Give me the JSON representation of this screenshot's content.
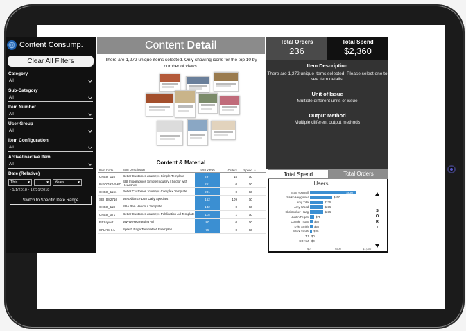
{
  "colors": {
    "accent_blue": "#3b8fd2",
    "panel_dark": "#111111",
    "panel_gray": "#333333",
    "header_gray": "#8b8b8b"
  },
  "brand": {
    "title": "Content Consump.",
    "icon": "globe-icon"
  },
  "filters": {
    "clear_label": "Clear All Filters",
    "items": [
      {
        "label": "Category",
        "value": "All"
      },
      {
        "label": "Sub-Category",
        "value": "All"
      },
      {
        "label": "Item Number",
        "value": "All"
      },
      {
        "label": "User Group",
        "value": "All"
      },
      {
        "label": "Item Configuration",
        "value": "All"
      },
      {
        "label": "Active/Inactive Item",
        "value": "All"
      }
    ],
    "date": {
      "label": "Date (Relative)",
      "mode": "This",
      "count": "",
      "unit": "Years",
      "range": "1/1/2018 - 12/31/2018"
    },
    "switch_label": "Switch to Specific Date Range"
  },
  "header": {
    "title_light": "Content ",
    "title_bold": "Detail"
  },
  "selection_message": "There are 1,272 unique items selected.  Only showing icons for the top 10 by number of views.",
  "content_material": {
    "title": "Content & Material",
    "columns": [
      "Item Code",
      "Item Description",
      "Item Views",
      "Orders",
      "Spend"
    ],
    "rows": [
      {
        "code": "CHSU_115",
        "desc": "Better Customer Journeys<br>Simple Template",
        "views": "297",
        "orders": "14",
        "spend": "$0"
      },
      {
        "code": "INFOGRAPHIC",
        "desc": "SBI Infographics<br>Simple Industry / Sector with Headshot",
        "views": "251",
        "orders": "0",
        "spend": "$0"
      },
      {
        "code": "CHSU_1161",
        "desc": "Better Customer Journeys<br>Complex Template",
        "views": "201",
        "orders": "0",
        "spend": "$0"
      },
      {
        "code": "SBI_D82710",
        "desc": "WebAlliance Dstr Daily Specials",
        "views": "152",
        "orders": "109",
        "spend": "$0"
      },
      {
        "code": "CHSU_118",
        "desc": "SBA Ben<br>Handout Template",
        "views": "132",
        "orders": "0",
        "spend": "$0"
      },
      {
        "code": "CHSU_071",
        "desc": "Better Customer Journeys<br>Publication Ad Template",
        "views": "115",
        "orders": "1",
        "spend": "$0"
      },
      {
        "code": "RRLayout",
        "desc": "WWW Retargeting Ad",
        "views": "80",
        "orders": "0",
        "spend": "$0"
      },
      {
        "code": "SPLASH-A",
        "desc": "Splash Page Template A Examples",
        "views": "75",
        "orders": "0",
        "spend": "$0"
      }
    ]
  },
  "kpis": {
    "orders_label": "Total Orders",
    "orders_value": "236",
    "spend_label": "Total Spend",
    "spend_value": "$2,360"
  },
  "item_info": {
    "desc_title": "Item Description",
    "desc_text": "There are 1,272 unique items selected. Please select one to see item details.",
    "unit_title": "Unit of Issue",
    "unit_text": "Multiple different units of issue",
    "output_title": "Output Method",
    "output_text": "Multiple different output methods"
  },
  "tabs": [
    {
      "label": "Total Spend",
      "active": true
    },
    {
      "label": "Total Orders",
      "active": false
    }
  ],
  "users_title": "Users",
  "sort_letters": [
    "S",
    "O",
    "R",
    "T"
  ],
  "chart_data": {
    "type": "bar",
    "orientation": "horizontal",
    "title": "Users",
    "categories": [
      "Scott Yourself",
      "Sarko Heggisser",
      "Amy Tilla",
      "Amy Wood",
      "Christopher Haag",
      "Justin Fegan",
      "Connie Truax",
      "Kyle Smith",
      "Mark Smith",
      "TJ",
      "CO AM"
    ],
    "values": [
      830,
      400,
      235,
      235,
      235,
      75,
      50,
      50,
      40,
      0,
      0
    ],
    "value_labels": [
      "$830",
      "$400",
      "$235",
      "$235",
      "$235",
      "$75",
      "$50",
      "$50",
      "$40",
      "$0",
      "$0"
    ],
    "xlim": [
      0,
      1000
    ],
    "xticks": [
      "$0",
      "$500",
      "$1,000"
    ],
    "grid": false
  }
}
